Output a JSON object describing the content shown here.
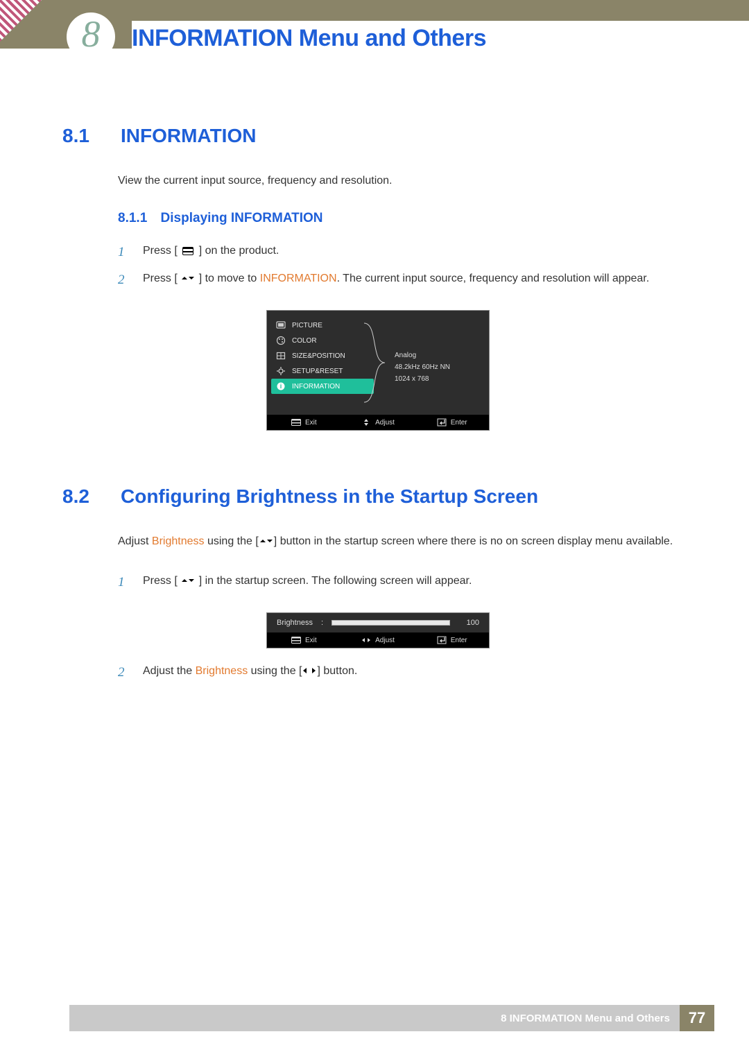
{
  "chapter": {
    "number": "8",
    "title": "INFORMATION Menu and Others"
  },
  "sections": {
    "s81": {
      "num": "8.1",
      "title": "INFORMATION",
      "intro": "View the current input source, frequency and resolution.",
      "sub_num": "8.1.1",
      "sub_title": "Displaying INFORMATION",
      "step1_a": "Press [",
      "step1_b": "] on the product.",
      "step2_a": "Press [",
      "step2_b": "] to move to ",
      "step2_hl": "INFORMATION",
      "step2_c": ". The current input source, frequency and resolution will appear."
    },
    "s82": {
      "num": "8.2",
      "title": "Configuring Brightness in the Startup Screen",
      "intro_a": "Adjust ",
      "intro_hl": "Brightness",
      "intro_b": " using the [",
      "intro_c": "] button in the startup screen where there is no on screen display menu available.",
      "step1_a": "Press [",
      "step1_b": "] in the startup screen. The following screen will appear.",
      "step2_a": "Adjust the ",
      "step2_hl": "Brightness",
      "step2_b": " using the [",
      "step2_c": "] button."
    }
  },
  "osd": {
    "menu": [
      "PICTURE",
      "COLOR",
      "SIZE&POSITION",
      "SETUP&RESET",
      "INFORMATION"
    ],
    "info": {
      "line1": "Analog",
      "line2": "48.2kHz 60Hz NN",
      "line3": "1024 x 768"
    },
    "footer": {
      "exit": "Exit",
      "adjust": "Adjust",
      "enter": "Enter"
    }
  },
  "bright_osd": {
    "label": "Brightness",
    "value": "100"
  },
  "footer": {
    "chapter_ref": "8 INFORMATION Menu and Others",
    "page": "77"
  }
}
